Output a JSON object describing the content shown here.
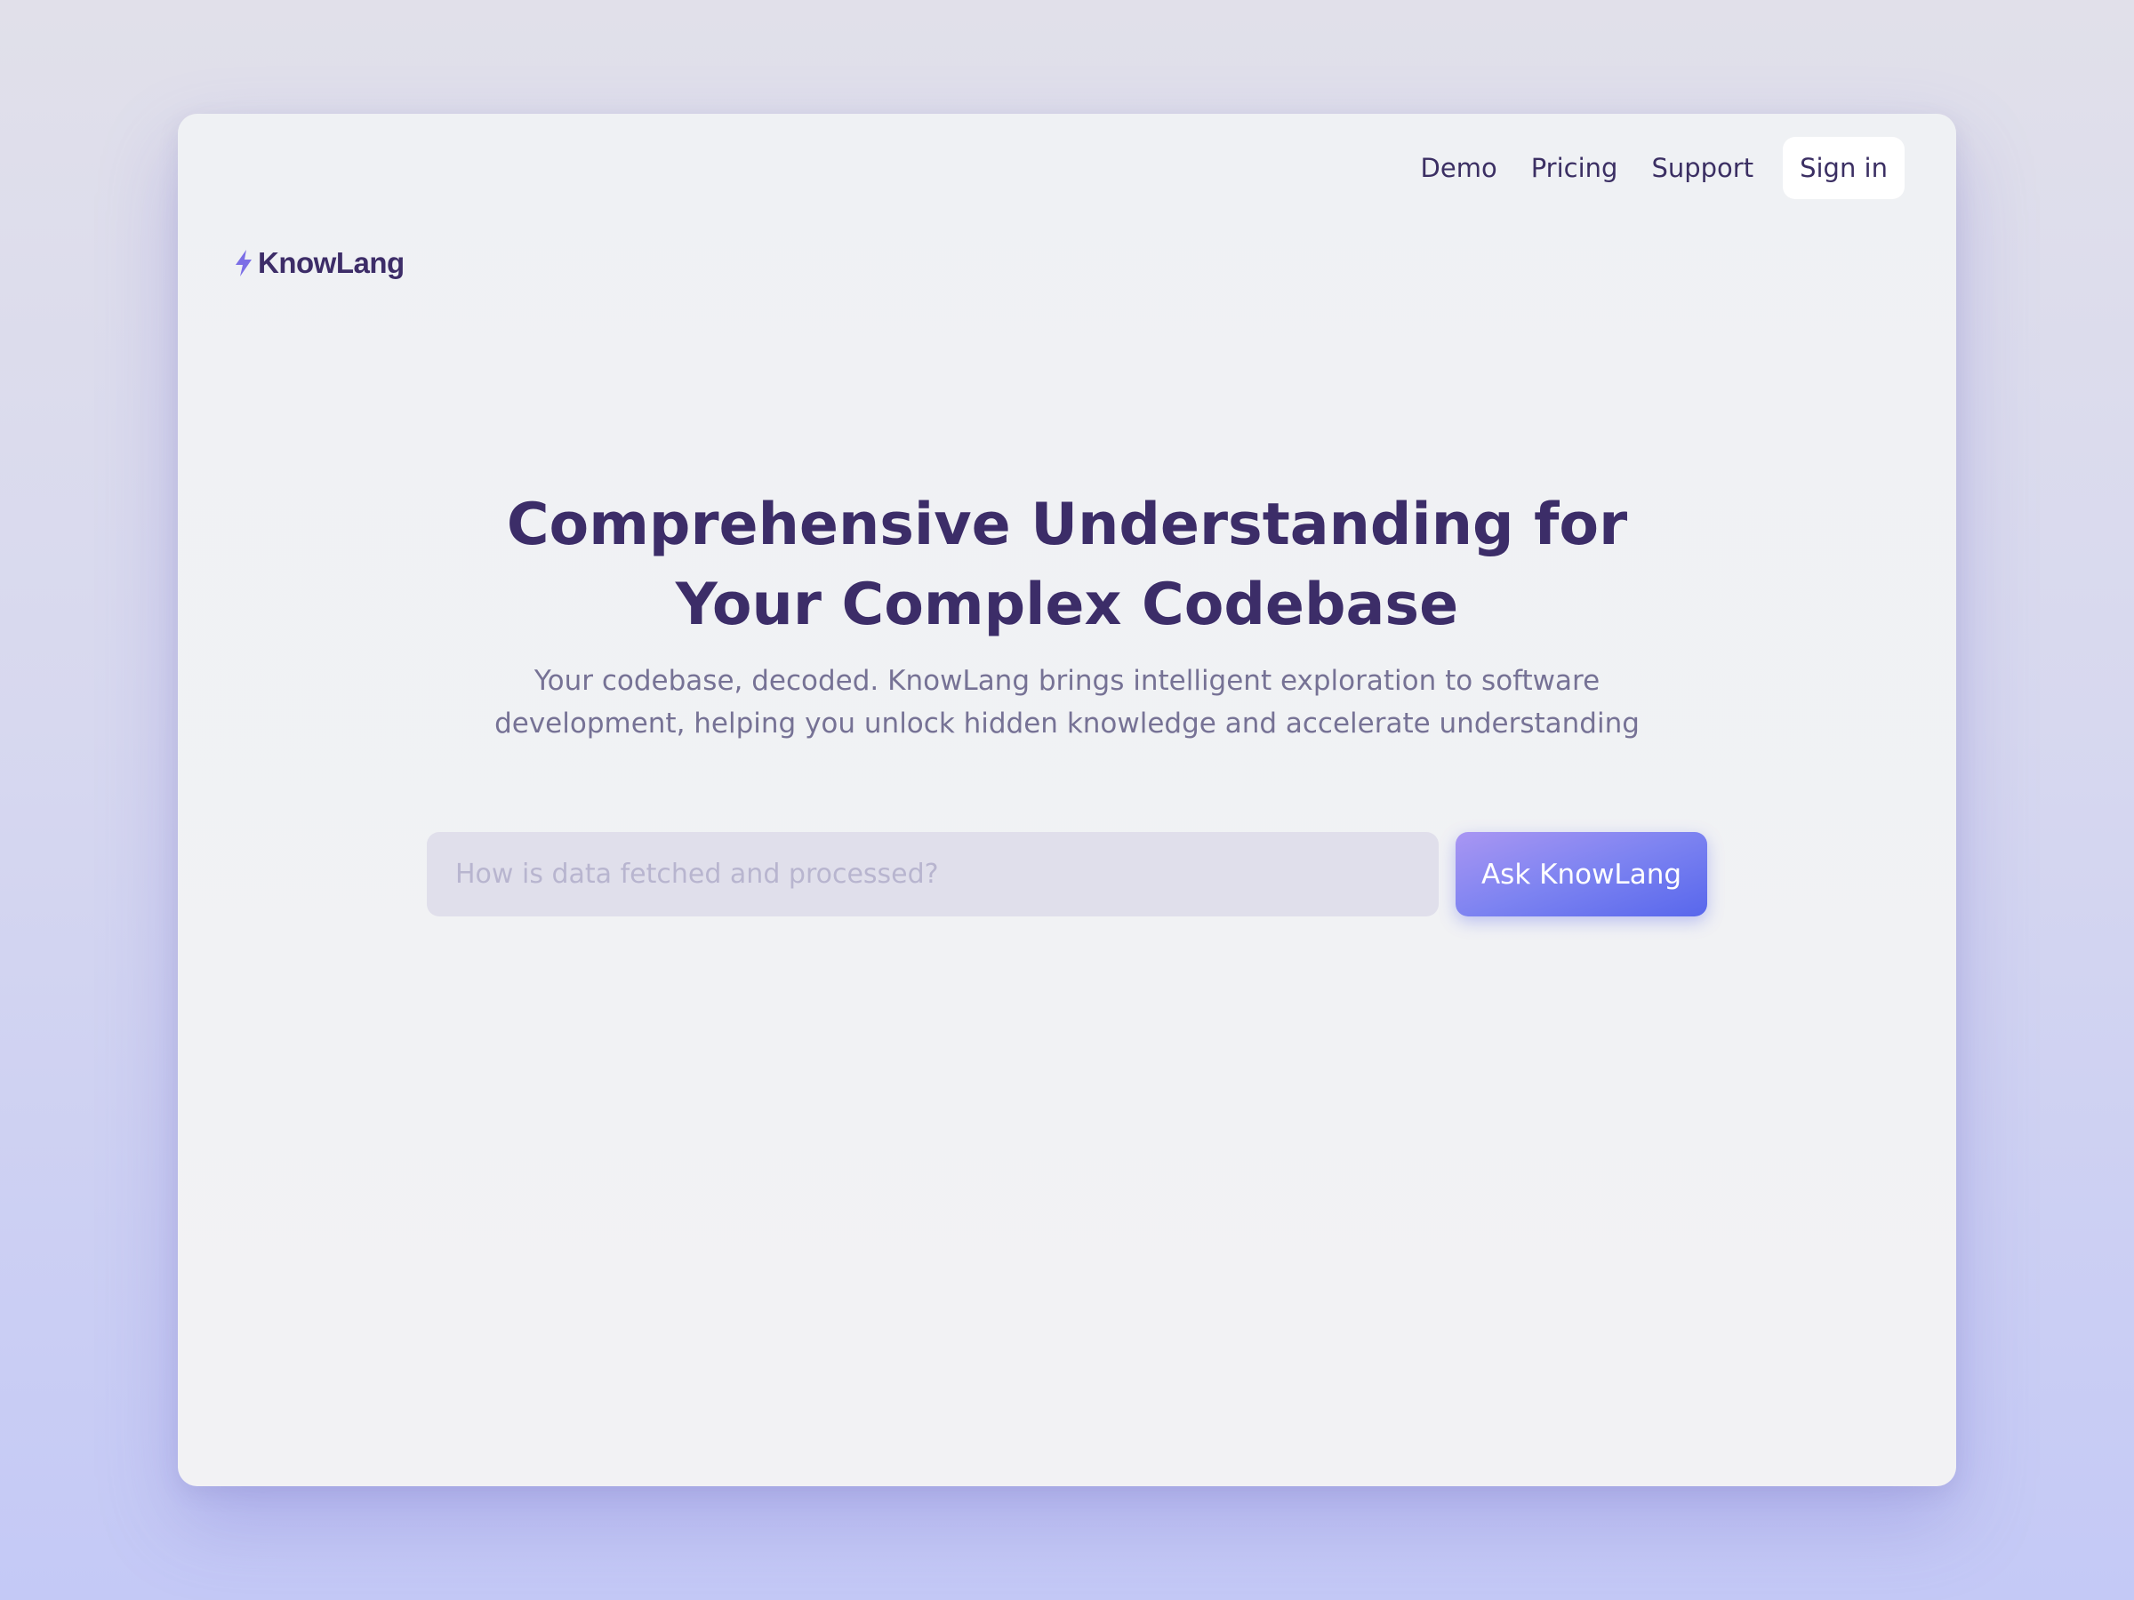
{
  "brand": {
    "name": "KnowLang",
    "icon": "lightning-bolt-icon",
    "icon_color": "#7b6ee6",
    "text_color": "#3d2d68"
  },
  "nav": {
    "links": [
      "Demo",
      "Pricing",
      "Support"
    ],
    "signin_label": "Sign in"
  },
  "hero": {
    "title_line1": "Comprehensive Understanding for",
    "title_line2": "Your Complex Codebase",
    "subtitle_line1": "Your codebase, decoded. KnowLang brings intelligent exploration to software",
    "subtitle_line2": "development, helping you unlock hidden knowledge and accelerate understanding"
  },
  "search": {
    "placeholder": "How is data fetched and processed?",
    "value": "",
    "button_label": "Ask KnowLang"
  },
  "colors": {
    "accent_start": "#a996f3",
    "accent_end": "#5867ec",
    "heading": "#3c2d68",
    "muted": "#767295"
  }
}
